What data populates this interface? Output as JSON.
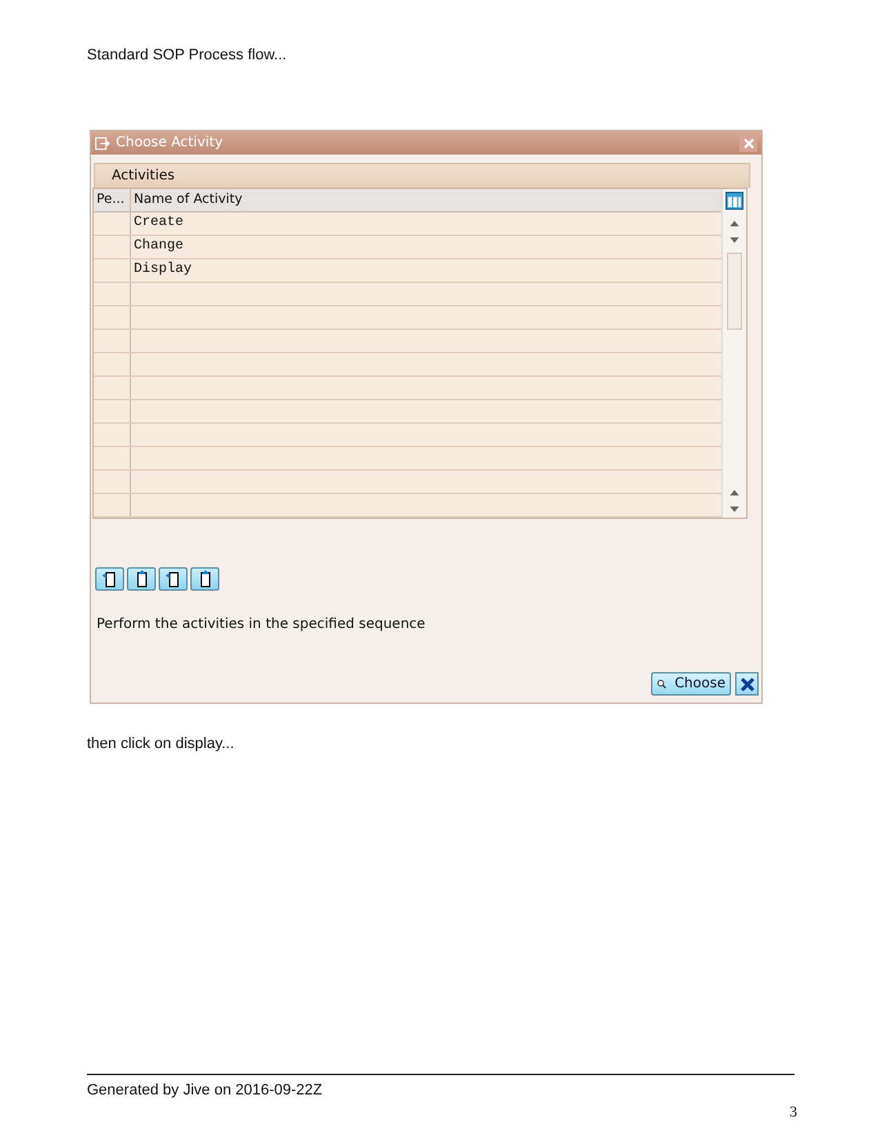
{
  "heading": "Standard SOP Process flow...",
  "dialog": {
    "title": "Choose Activity",
    "tab": "Activities",
    "columns": [
      "Pe...",
      "Name of Activity"
    ],
    "rows": [
      {
        "name": "Create"
      },
      {
        "name": "Change"
      },
      {
        "name": "Display"
      }
    ],
    "message": "Perform the activities in the specified sequence",
    "choose_button": "Choose"
  },
  "caption": "then click on display...",
  "footer": {
    "text": "Generated by Jive on 2016-09-22Z",
    "page": "3"
  }
}
